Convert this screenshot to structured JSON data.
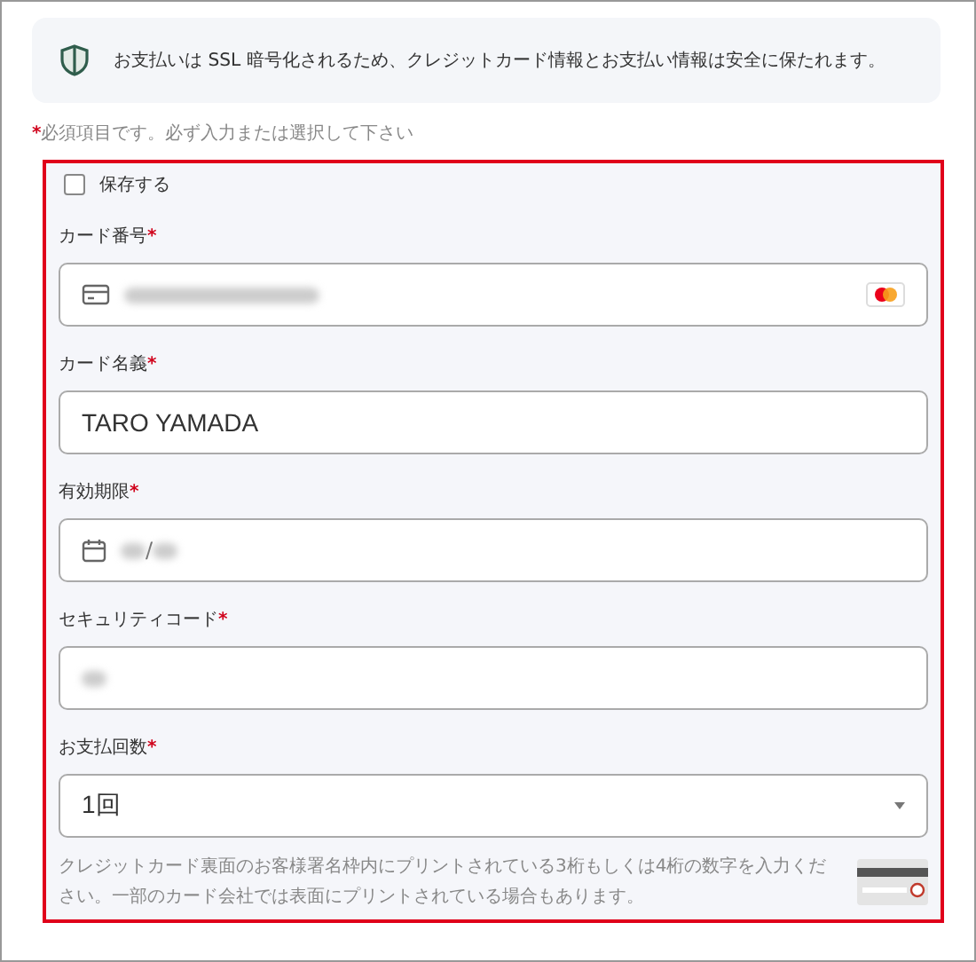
{
  "notice": {
    "text": "お支払いは SSL 暗号化されるため、クレジットカード情報とお支払い情報は安全に保たれます。"
  },
  "required_note": {
    "mark": "*",
    "text": "必須項目です。必ず入力または選択して下さい"
  },
  "save_option": {
    "label": "保存する",
    "checked": false
  },
  "fields": [
    {
      "kind": "card_number",
      "label": "カード番号",
      "required": true,
      "redacted": true
    },
    {
      "kind": "text",
      "label": "カード名義",
      "required": true,
      "value": "TARO YAMADA"
    },
    {
      "kind": "expiry",
      "label": "有効期限",
      "required": true,
      "redacted": true,
      "separator": "/"
    },
    {
      "kind": "text",
      "label": "セキュリティコード",
      "required": true,
      "redacted": true
    },
    {
      "kind": "select",
      "label": "お支払回数",
      "required": true,
      "value": "1回"
    }
  ],
  "help_text": "クレジットカード裏面のお客様署名枠内にプリントされている3桁もしくは4桁の数字を入力ください。一部のカード会社では表面にプリントされている場合もあります。"
}
